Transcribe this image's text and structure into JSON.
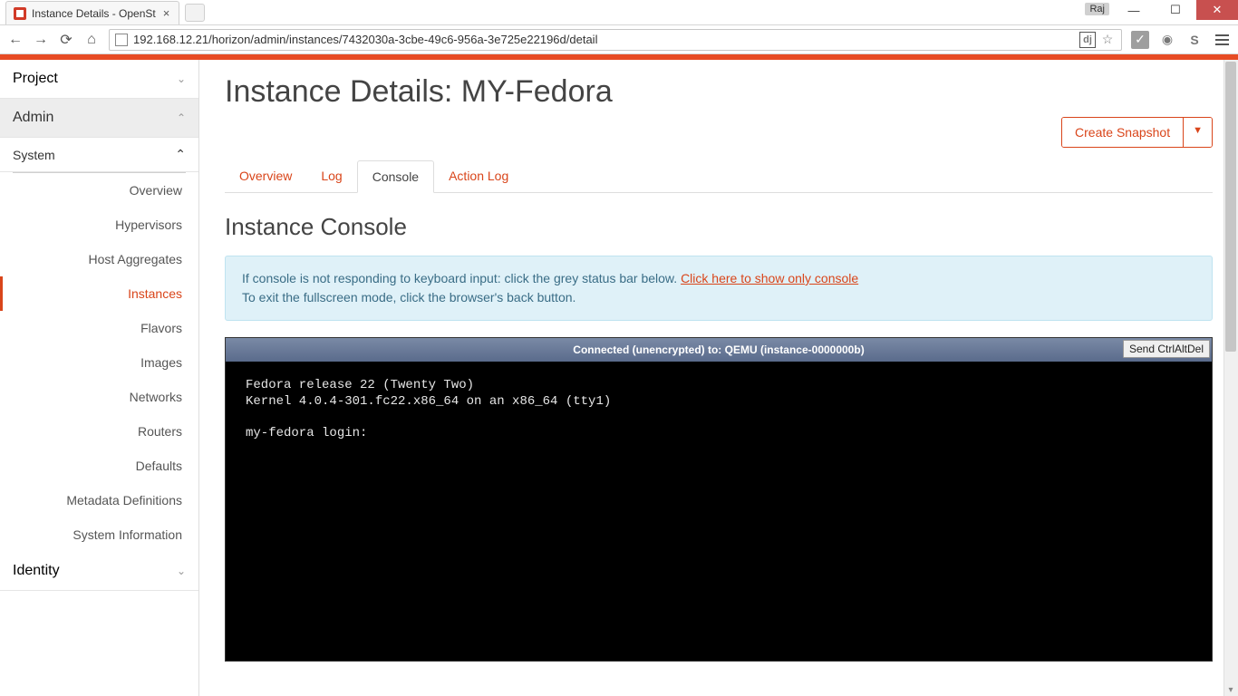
{
  "browser": {
    "tab_title": "Instance Details - OpenSt",
    "user_badge": "Raj",
    "url": "192.168.12.21/horizon/admin/instances/7432030a-3cbe-49c6-956a-3e725e22196d/detail",
    "ext_dj": "dj"
  },
  "sidebar": {
    "project": "Project",
    "admin": "Admin",
    "system": "System",
    "items": [
      "Overview",
      "Hypervisors",
      "Host Aggregates",
      "Instances",
      "Flavors",
      "Images",
      "Networks",
      "Routers",
      "Defaults",
      "Metadata Definitions",
      "System Information"
    ],
    "identity": "Identity"
  },
  "page": {
    "title": "Instance Details: MY-Fedora",
    "snapshot_btn": "Create Snapshot",
    "tabs": [
      "Overview",
      "Log",
      "Console",
      "Action Log"
    ],
    "section_title": "Instance Console",
    "info_line1a": "If console is not responding to keyboard input: click the grey status bar below. ",
    "info_link": "Click here to show only console",
    "info_line2": "To exit the fullscreen mode, click the browser's back button."
  },
  "console": {
    "status": "Connected (unencrypted) to: QEMU (instance-0000000b)",
    "send_btn": "Send CtrlAltDel",
    "text": "Fedora release 22 (Twenty Two)\nKernel 4.0.4-301.fc22.x86_64 on an x86_64 (tty1)\n\nmy-fedora login:"
  }
}
